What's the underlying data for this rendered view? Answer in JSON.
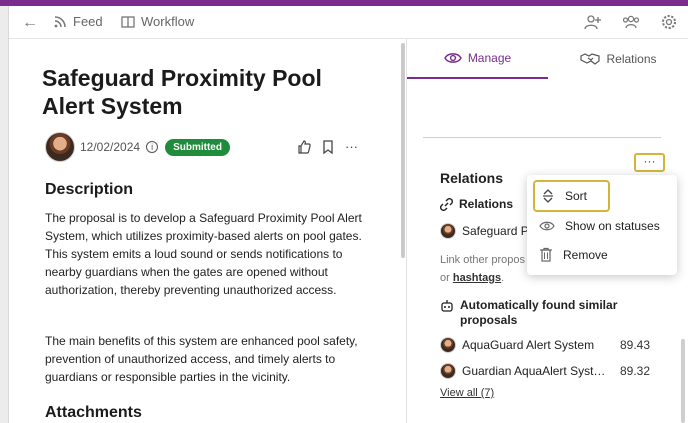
{
  "nav": {
    "feed_label": "Feed",
    "workflow_label": "Workflow"
  },
  "proposal": {
    "title": "Safeguard Proximity Pool Alert System",
    "date": "12/02/2024",
    "status": "Submitted",
    "sections": {
      "description_title": "Description",
      "paragraph_1": "The proposal is to develop a Safeguard Proximity Pool Alert System, which utilizes proximity-based alerts on pool gates. This system emits a loud sound or sends notifications to nearby guardians when the gates are opened without authorization, thereby preventing unauthorized access.",
      "paragraph_2": "The main benefits of this system are enhanced pool safety, prevention of unauthorized access, and timely alerts to guardians or responsible parties in the vicinity.",
      "attachments_title": "Attachments"
    }
  },
  "panel": {
    "tabs": [
      {
        "label": "Manage",
        "active": true
      },
      {
        "label": "Relations",
        "active": false
      }
    ],
    "relations_title": "Relations",
    "relations_subtitle": "Relations",
    "relation_item": "Safeguard P",
    "hint_text": "Link other propos",
    "hint_text_2": "or",
    "hint_tag": "hashtags",
    "hint_end": ".",
    "auto_title": "Automatically found similar proposals",
    "similar": [
      {
        "name": "AquaGuard Alert System",
        "score": "89.43"
      },
      {
        "name": "Guardian AquaAlert System",
        "score": "89.32"
      }
    ],
    "view_all": "View all (7)",
    "more_label": "···"
  },
  "context_menu": {
    "items": [
      {
        "label": "Sort",
        "icon": "sort-icon"
      },
      {
        "label": "Show on statuses",
        "icon": "eye-icon"
      },
      {
        "label": "Remove",
        "icon": "trash-icon"
      }
    ]
  },
  "colors": {
    "accent": "#7b2d8e",
    "status_green": "#1e8c3a",
    "highlight": "#d4b53a"
  }
}
